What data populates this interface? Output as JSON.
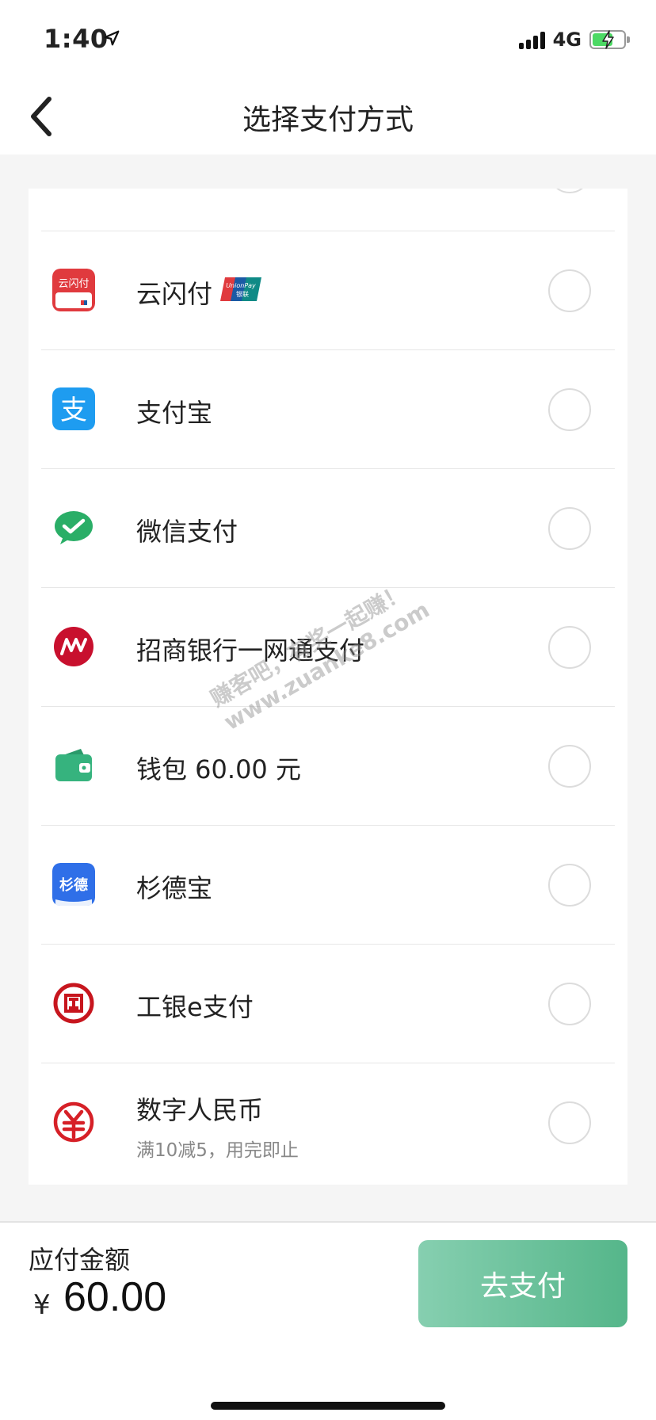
{
  "status_bar": {
    "time": "1:40",
    "network": "4G",
    "battery_level": 0.65
  },
  "nav": {
    "title": "选择支付方式"
  },
  "payment_methods": [
    {
      "label": "",
      "sub": "",
      "icon": "bank-card-icon"
    },
    {
      "label": "云闪付",
      "sub": "",
      "icon": "unionpay-app-icon",
      "badge": "UnionPay 银联"
    },
    {
      "label": "支付宝",
      "sub": "",
      "icon": "alipay-icon"
    },
    {
      "label": "微信支付",
      "sub": "",
      "icon": "wechat-pay-icon"
    },
    {
      "label": "招商银行一网通支付",
      "sub": "",
      "icon": "cmb-icon"
    },
    {
      "label": "钱包 60.00 元",
      "sub": "",
      "icon": "wallet-icon"
    },
    {
      "label": "杉德宝",
      "sub": "",
      "icon": "sandpay-icon"
    },
    {
      "label": "工银e支付",
      "sub": "",
      "icon": "icbc-icon"
    },
    {
      "label": "数字人民币",
      "sub": "满10减5，用完即止",
      "icon": "digital-rmb-icon"
    }
  ],
  "watermark": {
    "line1": "赚客吧，有奖一起赚！",
    "line2": "www.zuanke8.com"
  },
  "bottom": {
    "amount_label": "应付金额",
    "currency": "¥",
    "amount": "60.00",
    "pay_button": "去支付"
  },
  "colors": {
    "accent": "#55b68a",
    "unionpay_red": "#e03a3e",
    "alipay_blue": "#1e9cf0",
    "wechat_green": "#2aae67",
    "cmb_red": "#c8102e",
    "wallet_green": "#36b37e",
    "sand_blue": "#2f6fe8",
    "icbc_red": "#c7161e"
  }
}
